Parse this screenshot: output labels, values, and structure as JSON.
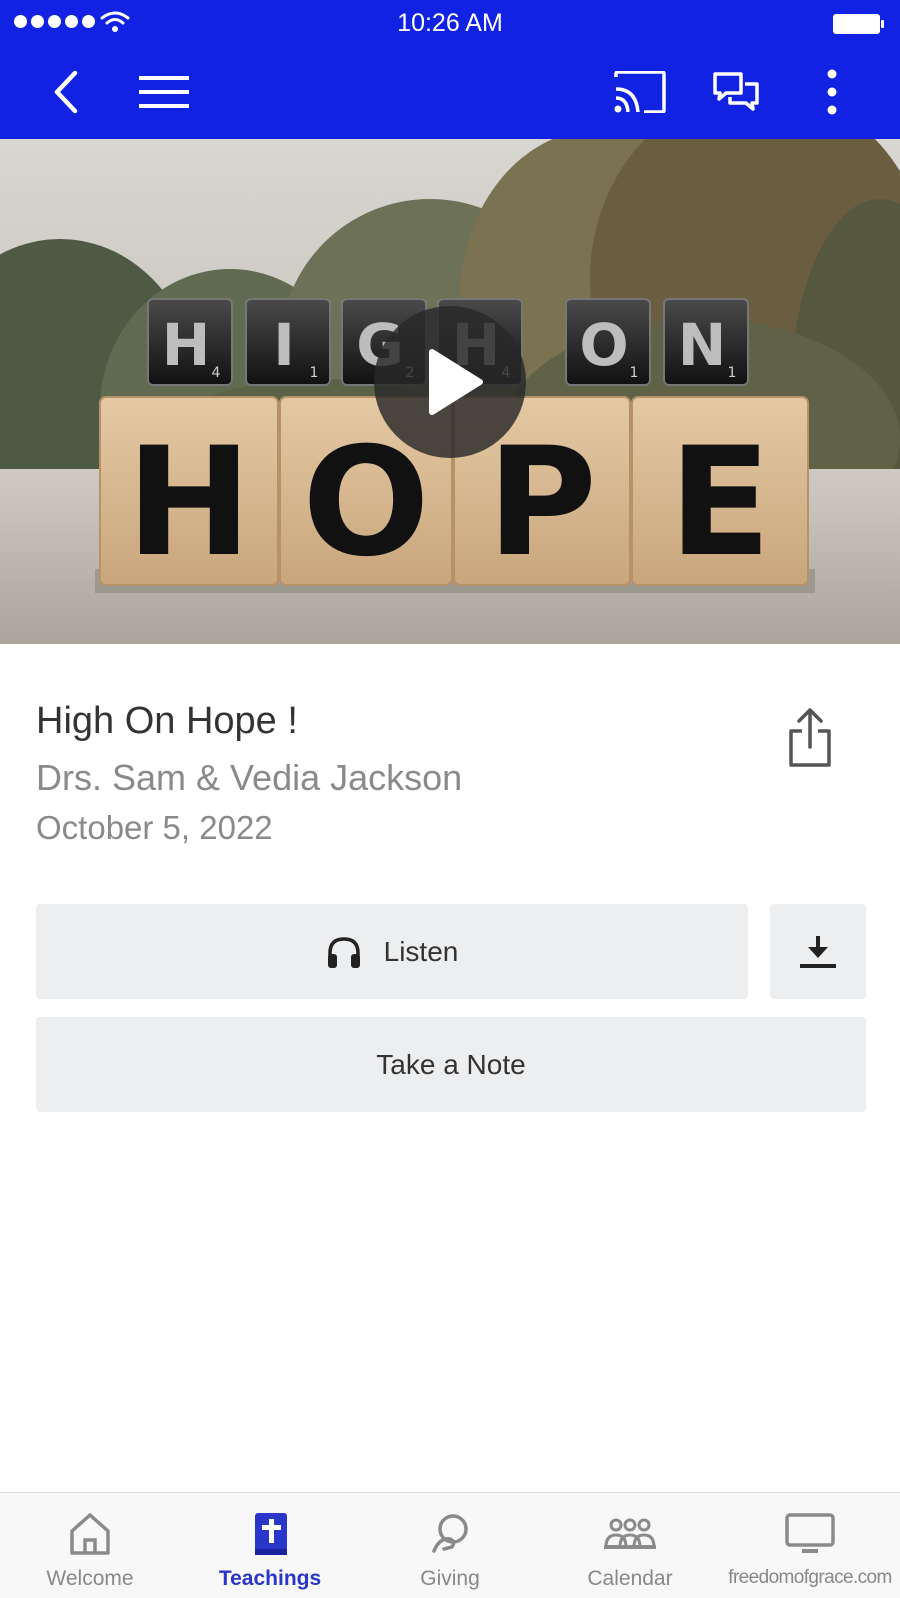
{
  "status_bar": {
    "time": "10:26 AM"
  },
  "toolbar": {
    "back_icon": "chevron-left-icon",
    "menu_icon": "hamburger-menu-icon",
    "cast_icon": "cast-icon",
    "chat_icon": "chat-bubbles-icon",
    "more_icon": "more-vertical-icon"
  },
  "hero": {
    "top_tiles": [
      "H",
      "I",
      "G",
      "H",
      "O",
      "N"
    ],
    "top_tile_scores": [
      "4",
      "1",
      "2",
      "4",
      "1",
      "1"
    ],
    "blocks": [
      "H",
      "O",
      "P",
      "E"
    ]
  },
  "media": {
    "title": "High On Hope !",
    "speaker": "Drs. Sam & Vedia Jackson",
    "date": "October 5, 2022"
  },
  "actions": {
    "listen_label": "Listen",
    "note_label": "Take a Note"
  },
  "tabs": [
    {
      "label": "Welcome",
      "icon": "home-icon",
      "active": false
    },
    {
      "label": "Teachings",
      "icon": "bible-icon",
      "active": true
    },
    {
      "label": "Giving",
      "icon": "giving-icon",
      "active": false
    },
    {
      "label": "Calendar",
      "icon": "people-icon",
      "active": false
    },
    {
      "label": "freedomofgrace.com",
      "icon": "monitor-icon",
      "active": false
    }
  ],
  "colors": {
    "brand_blue": "#1222e3",
    "active_tab": "#2a36c9",
    "button_bg": "#edeef0"
  }
}
